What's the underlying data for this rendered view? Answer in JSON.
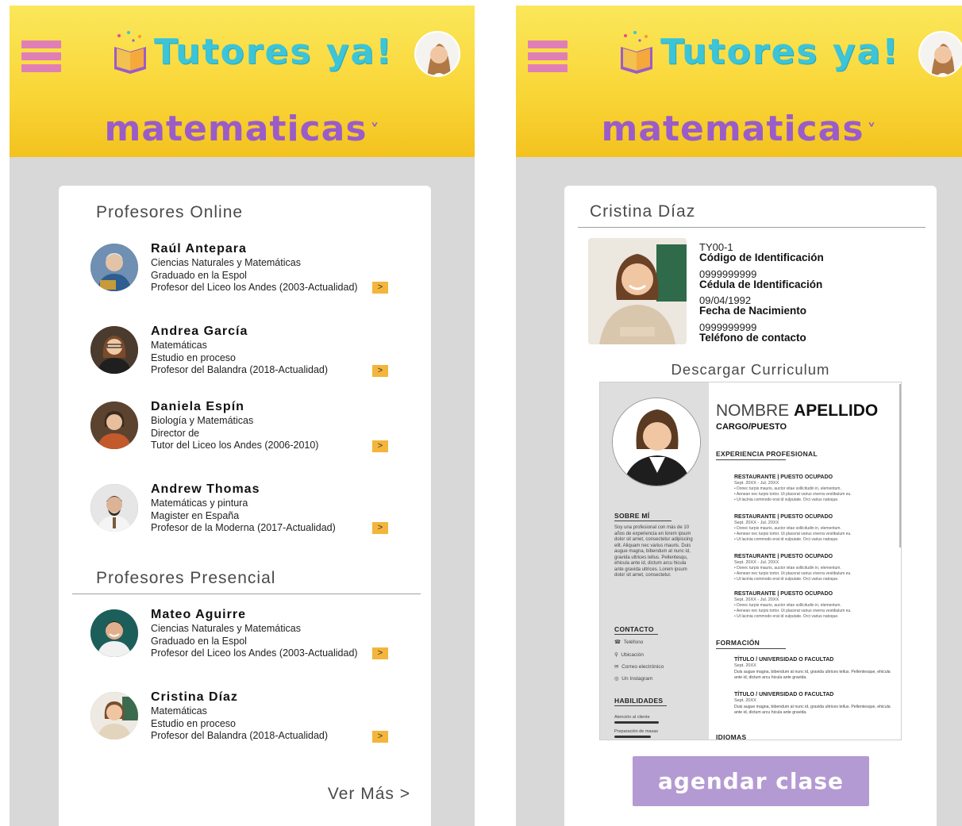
{
  "app": {
    "name": "Tutores ya!"
  },
  "header": {
    "subject": "matematicas",
    "subject_chevron": "˅"
  },
  "screen1": {
    "online_title": "Profesores Online",
    "presencial_title": "Profesores Presencial",
    "more_label": "Ver Más >",
    "arrow_label": ">",
    "online_teachers": [
      {
        "name": "Raúl Antepara",
        "line1": "Ciencias Naturales y Matemáticas",
        "line2": "Graduado en la Espol",
        "line3": "Profesor del Liceo los Andes  (2003-Actualidad)"
      },
      {
        "name": "Andrea García",
        "line1": "Matemáticas",
        "line2": "Estudio en proceso",
        "line3": "Profesor del Balandra  (2018-Actualidad)"
      },
      {
        "name": "Daniela Espín",
        "line1": "Biología y Matemáticas",
        "line2": "Director de",
        "line3": "Tutor del Liceo los Andes  (2006-2010)"
      },
      {
        "name": "Andrew Thomas",
        "line1": "Matemáticas y pintura",
        "line2": "Magister en España",
        "line3": "Profesor de la Moderna (2017-Actualidad)"
      }
    ],
    "presencial_teachers": [
      {
        "name": "Mateo Aguirre",
        "line1": "Ciencias Naturales y Matemáticas",
        "line2": "Graduado en la Espol",
        "line3": "Profesor del Liceo los Andes  (2003-Actualidad)"
      },
      {
        "name": "Cristina Díaz",
        "line1": "Matemáticas",
        "line2": "Estudio en proceso",
        "line3": "Profesor del Balandra  (2018-Actualidad)"
      }
    ]
  },
  "screen2": {
    "profile_name": "Cristina Díaz",
    "fields": [
      {
        "value": "TY00-1",
        "label": "Código de Identificación"
      },
      {
        "value": "0999999999",
        "label": "Cédula de Identificación"
      },
      {
        "value": "09/04/1992",
        "label": "Fecha de Nacimiento"
      },
      {
        "value": "0999999999",
        "label": "Teléfono de contacto"
      }
    ],
    "download_label": "Descargar Curriculum",
    "cta_label": "agendar clase",
    "cv": {
      "first_name": "NOMBRE",
      "last_name": "APELLIDO",
      "role": "CARGO/PUESTO",
      "experience_title": "EXPERIENCIA PROFESIONAL",
      "jobs": [
        {
          "title": "RESTAURANTE | PUESTO OCUPADO",
          "dates": "Sept. 20XX - Jul. 20XX"
        },
        {
          "title": "RESTAURANTE | PUESTO OCUPADO",
          "dates": "Sept. 20XX - Jul. 20XX"
        },
        {
          "title": "RESTAURANTE | PUESTO OCUPADO",
          "dates": "Sept. 20XX - Jul. 20XX"
        },
        {
          "title": "RESTAURANTE | PUESTO OCUPADO",
          "dates": "Sept. 20XX - Jul. 20XX"
        }
      ],
      "bullets": [
        "• Donec turpis mauris, auctor vitae sollicitudin in, elementum.",
        "• Aenean nec turpis tortor. Ut placerat varius viverra vestibulum eu.",
        "• Ut lacinia commodo erat id vulputate. Orci varius natoque."
      ],
      "formation_title": "FORMACIÓN",
      "degrees": [
        {
          "title": "TÍTULO / UNIVERSIDAD O FACULTAD",
          "dates": "Sept. 20XX",
          "desc": "Duis augue magna, bibendum at nunc id, gravida ultrices tellus. Pellentesque, ehicula ante id, dictum arcu hicula ante gravida."
        },
        {
          "title": "TÍTULO / UNIVERSIDAD O FACULTAD",
          "dates": "Sept. 20XX",
          "desc": "Duis augue magna, bibendum at nunc id, gravida ultrices tellus. Pellentesque, ehicula ante id, dictum arcu hicula ante gravida."
        }
      ],
      "languages_title": "IDIOMAS",
      "about_title": "SOBRE MÍ",
      "about_text": "Soy una profesional con más de 10 años de experiencia en lorem ipsum dolor sit amet, consectetur adipiscing elit. Aliquam nec varius mauris. Duis augue magna, bibendum at nunc id, gravida ultrices tellus. Pellentesqu, ehicula ante id, dictum arcu hicula ante gravida ultrices. Lorem ipsum dolor sit amet, consectetur.",
      "contact_title": "CONTACTO",
      "contact": [
        {
          "icon": "phone-icon",
          "glyph": "☎",
          "text": "Teléfono"
        },
        {
          "icon": "location-icon",
          "glyph": "⚲",
          "text": "Ubicación"
        },
        {
          "icon": "mail-icon",
          "glyph": "✉",
          "text": "Correo electrónico"
        },
        {
          "icon": "instagram-icon",
          "glyph": "◎",
          "text": "Un Instagram"
        }
      ],
      "skills_title": "HABILIDADES",
      "skills": [
        {
          "name": "Atención al cliente",
          "level": 0.85
        },
        {
          "name": "Preparación de masas",
          "level": 0.7
        }
      ]
    }
  },
  "colors": {
    "header": "#f9d536",
    "hamburger": "#e07fb6",
    "logo": "#3cc4d8",
    "subject": "#9a5cc8",
    "button": "#f3b53b",
    "cta": "#b49ad3"
  }
}
